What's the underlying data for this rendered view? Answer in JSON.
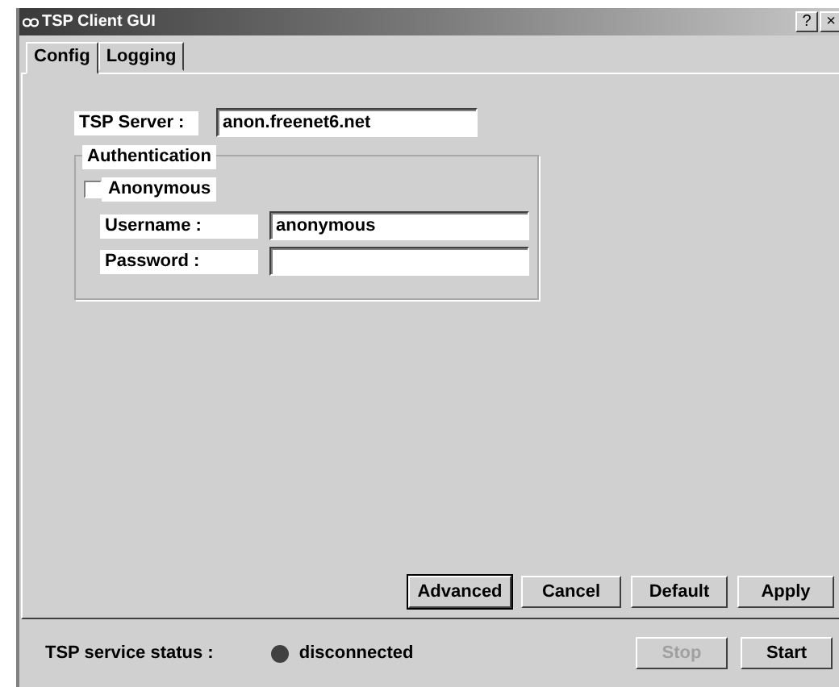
{
  "window": {
    "title": "TSP Client GUI",
    "help_button": "?",
    "close_button": "×"
  },
  "tabs": [
    {
      "label": "Config",
      "selected": true
    },
    {
      "label": "Logging",
      "selected": false
    }
  ],
  "config": {
    "server_label": "TSP Server :",
    "server_value": "anon.freenet6.net",
    "authentication": {
      "legend": "Authentication",
      "anonymous": {
        "label": "Anonymous",
        "checked": false
      },
      "username_label": "Username :",
      "username_value": "anonymous",
      "password_label": "Password :"
    }
  },
  "buttons": [
    {
      "label": "Advanced",
      "default": true
    },
    {
      "label": "Cancel",
      "default": false
    },
    {
      "label": "Default",
      "default": false
    },
    {
      "label": "Apply",
      "default": false
    }
  ],
  "status_bar": {
    "label": "TSP service status :",
    "status": "disconnected",
    "color": "#404040",
    "buttons": [
      {
        "label": "Stop",
        "disabled": true
      },
      {
        "label": "Start",
        "disabled": false
      }
    ]
  }
}
